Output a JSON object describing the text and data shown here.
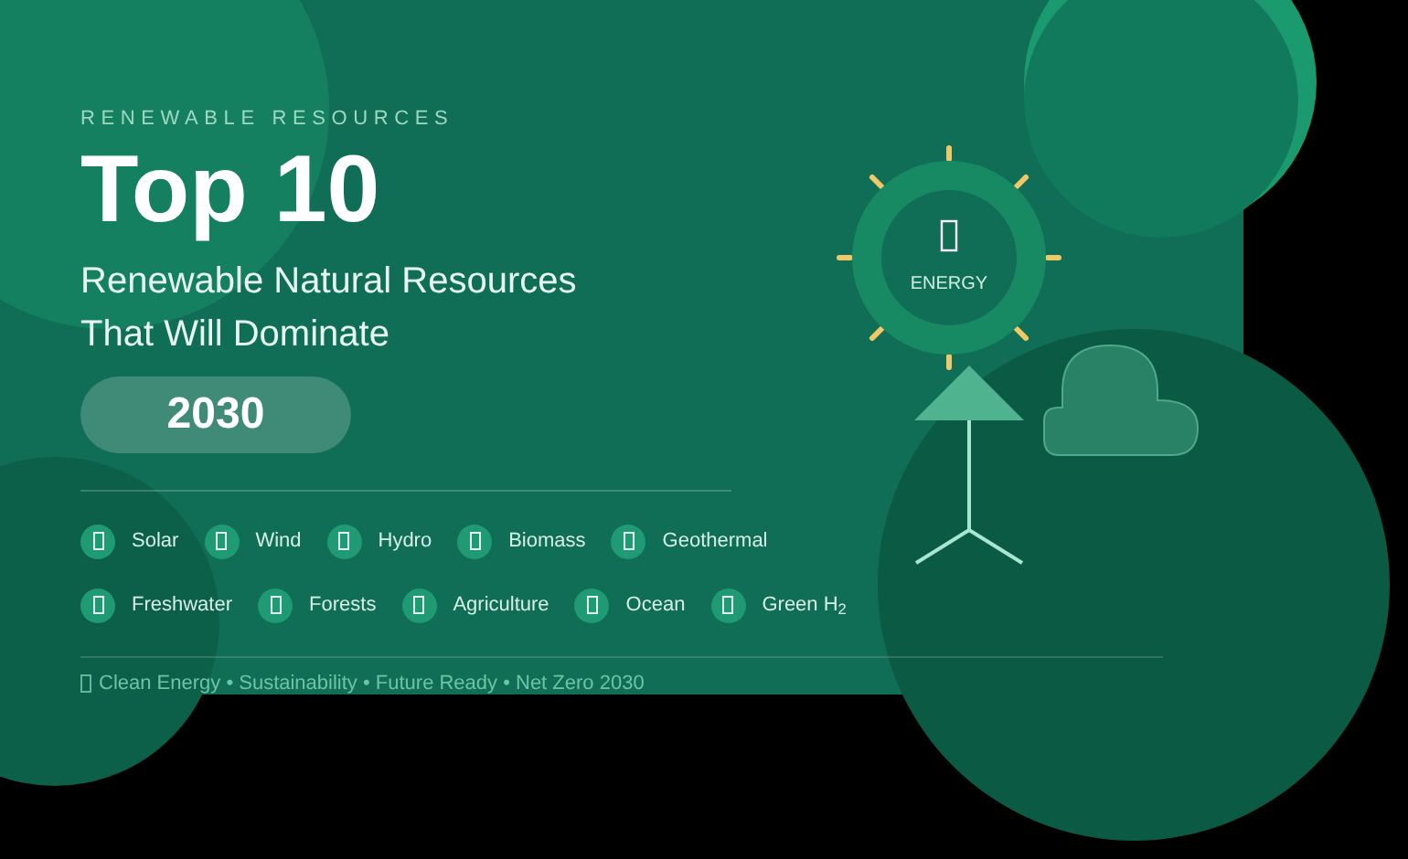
{
  "eyebrow": "RENEWABLE RESOURCES",
  "title": "Top 10",
  "subtitle": [
    "Renewable Natural Resources",
    "That Will Dominate"
  ],
  "year": "2030",
  "resource_rows": [
    [
      "Solar",
      "Wind",
      "Hydro",
      "Biomass",
      "Geothermal"
    ],
    [
      "Freshwater",
      "Forests",
      "Agriculture",
      "Ocean",
      "Green H$_{2}$"
    ]
  ],
  "footer": "Clean Energy • Sustainability • Future Ready • Net Zero 2030",
  "sun_label": "ENERGY"
}
